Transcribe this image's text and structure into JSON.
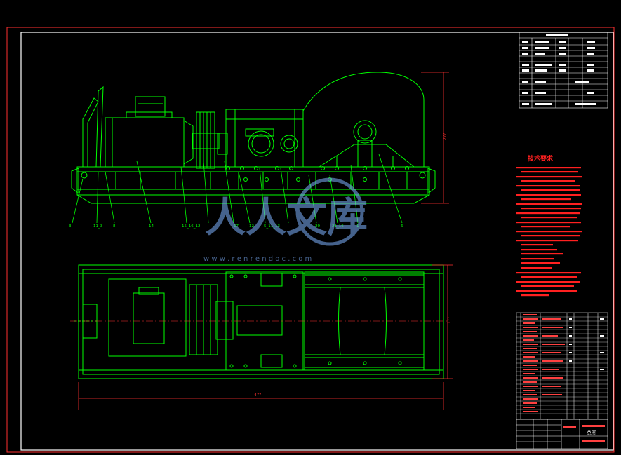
{
  "drawing": {
    "technical_requirements_title": "技术要求",
    "title_block_name": "总图"
  },
  "dimensions": {
    "overall_length": "4??",
    "overall_height": "2??",
    "overall_width": "1??"
  },
  "callouts": [
    "3",
    "11_3",
    "8",
    "14",
    "15_16_12",
    "17",
    "12",
    "5_11_13",
    "20",
    "21_16",
    "1",
    "6"
  ],
  "watermark": {
    "brand": "人人文库",
    "url": "w w w . r e n r e n d o c . c o m"
  },
  "colors": {
    "background": "#000000",
    "line": "#00ff00",
    "frame": "#ff3030",
    "dimension": "#ff3030",
    "note_text": "#ff2020",
    "table_text": "#ffffff",
    "table_accent": "#ff4040",
    "watermark": "#7fb2ff"
  }
}
